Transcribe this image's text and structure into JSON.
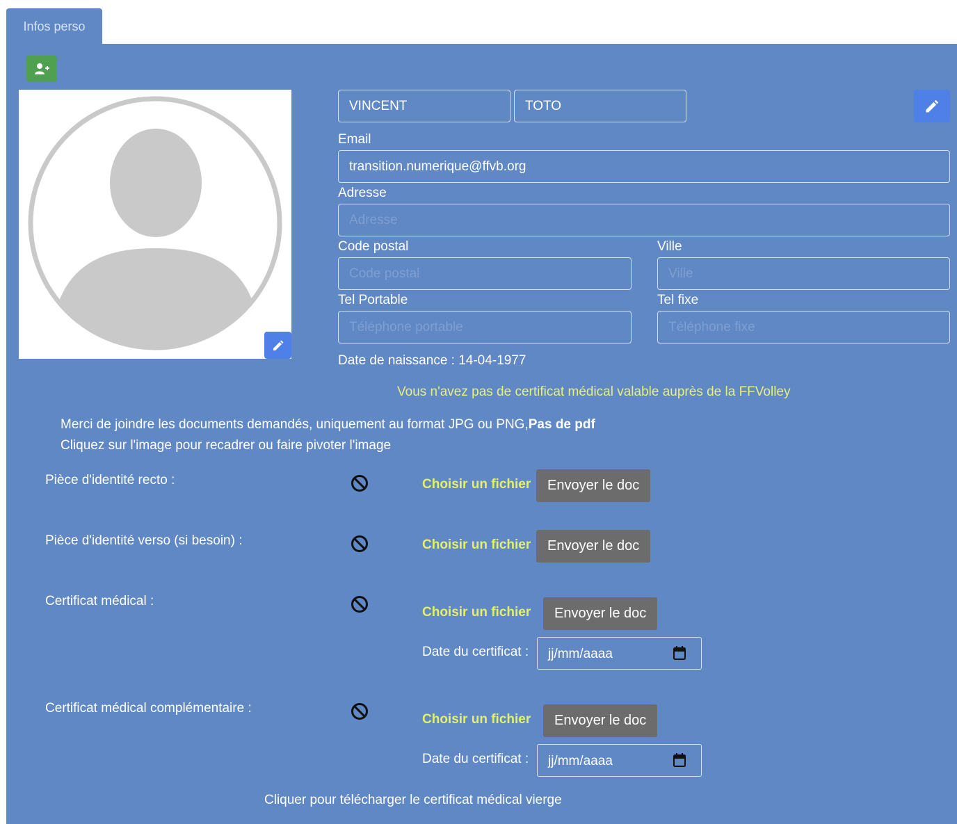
{
  "tab": {
    "label": "Infos perso"
  },
  "profile": {
    "first_name": "VINCENT",
    "last_name": "TOTO",
    "email_label": "Email",
    "email_value": "transition.numerique@ffvb.org",
    "address_label": "Adresse",
    "address_placeholder": "Adresse",
    "postal_label": "Code postal",
    "postal_placeholder": "Code postal",
    "city_label": "Ville",
    "city_placeholder": "Ville",
    "mobile_label": "Tel Portable",
    "mobile_placeholder": "Téléphone portable",
    "phone_label": "Tel fixe",
    "phone_placeholder": "Téléphone fixe",
    "birthdate_text": "Date de naissance : 14-04-1977"
  },
  "warning": "Vous n'avez pas de certificat médical valable auprès de la FFVolley",
  "info": {
    "line1": "Merci de joindre les documents demandés, uniquement au format JPG ou PNG,",
    "line1_bold": "Pas de pdf",
    "line2": "Cliquez sur l'image pour recadrer ou faire pivoter l'image"
  },
  "documents": [
    {
      "label": "Pièce d'identité recto :",
      "choose": "Choisir un fichier",
      "send": "Envoyer le doc"
    },
    {
      "label": "Pièce d'identité verso (si besoin) :",
      "choose": "Choisir un fichier",
      "send": "Envoyer le doc"
    },
    {
      "label": "Certificat médical :",
      "choose": "Choisir un fichier",
      "send": "Envoyer le doc",
      "date_label": "Date du certificat :",
      "date_placeholder": "jj/mm/aaaa"
    },
    {
      "label": "Certificat médical complémentaire :",
      "choose": "Choisir un fichier",
      "send": "Envoyer le doc",
      "date_label": "Date du certificat :",
      "date_placeholder": "jj/mm/aaaa"
    }
  ],
  "download_link": "Cliquer pour télécharger le certificat médical vierge",
  "icons": {
    "add_user": "user-plus-icon",
    "edit": "pencil-icon",
    "ban": "ban-icon",
    "calendar": "calendar-icon",
    "avatar": "avatar-placeholder"
  },
  "colors": {
    "panel": "#5f88c5",
    "edit_button": "#4e80e8",
    "add_button": "#4fa14f",
    "warning_text": "#e8f07a",
    "choose_file_text": "#e5ef6a",
    "send_button": "#6c6c6c"
  }
}
